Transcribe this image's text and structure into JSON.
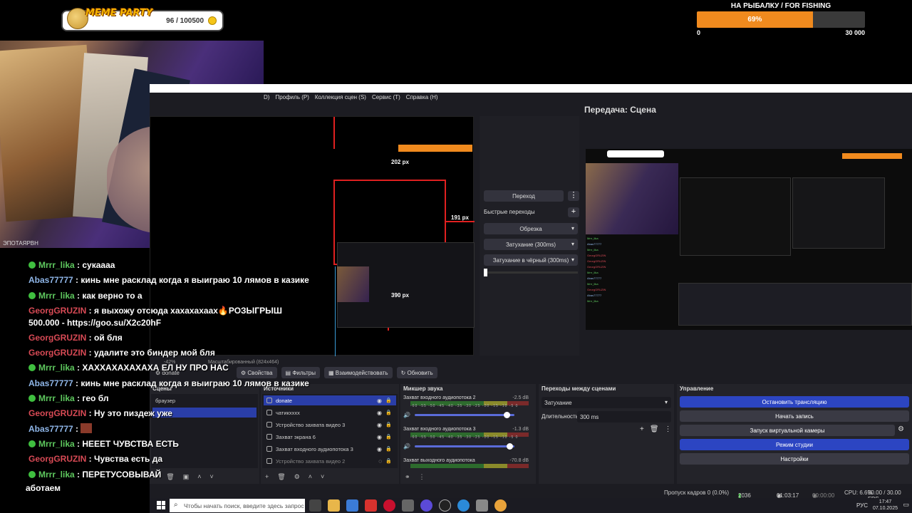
{
  "overlay": {
    "meme_party": {
      "title": "MEME PARTY",
      "count": "96 / 100500"
    },
    "fishing": {
      "title": "НА РЫБАЛКУ / FOR FISHING",
      "percent_label": "69%",
      "progress": 0.69,
      "min": "0",
      "max": "30 000"
    },
    "webcam_caption": "ЭПОТАЯРВН"
  },
  "chat": {
    "messages": [
      {
        "user": "Mrrr_lika",
        "text": "сукаааа",
        "color": "green",
        "badge": true
      },
      {
        "user": "Abas77777",
        "text": "кинь мне расклад когда я выиграю 10 лямов в казике",
        "color": "blue",
        "badge": false
      },
      {
        "user": "Mrrr_lika",
        "text": "как верно то а",
        "color": "green",
        "badge": true
      },
      {
        "user": "GeorgGRUZIN",
        "text": "я выхожу отсюда хахахахаах🔥РОЗЫГРЫШ 500.000 - https://goo.su/X2c20hF",
        "color": "red",
        "badge": false
      },
      {
        "user": "GeorgGRUZIN",
        "text": "ой бля",
        "color": "red",
        "badge": false
      },
      {
        "user": "GeorgGRUZIN",
        "text": "удалите это биндер мой бля",
        "color": "red",
        "badge": false
      },
      {
        "user": "Mrrr_lika",
        "text": "ХАХХАХАХАХАХА ЕЛ НУ ПРО НАС",
        "color": "green",
        "badge": true
      },
      {
        "user": "Abas77777",
        "text": "кинь мне расклад когда я выиграю 10 лямов в казике",
        "color": "blue",
        "badge": false
      },
      {
        "user": "Mrrr_lika",
        "text": "гео бл",
        "color": "green",
        "badge": true
      },
      {
        "user": "GeorgGRUZIN",
        "text": "Ну это пиздеж уже",
        "color": "red",
        "badge": false
      },
      {
        "user": "Abas77777",
        "text": "",
        "color": "blue",
        "badge": false,
        "emote": true
      },
      {
        "user": "Mrrr_lika",
        "text": "НЕЕЕТ ЧУВСТВА ЕСТЬ",
        "color": "green",
        "badge": true
      },
      {
        "user": "GeorgGRUZIN",
        "text": "Чувства есть да",
        "color": "red",
        "badge": false
      },
      {
        "user": "Mrrr_lika",
        "text": "ПЕРЕТУСОВЫВАЙ",
        "color": "green",
        "badge": true
      }
    ],
    "tail": "аботаем"
  },
  "obs": {
    "menu": [
      "D)",
      "Профиль (P)",
      "Коллекция сцен (S)",
      "Сервис (T)",
      "Справка (H)"
    ],
    "program_title": "Передача: Сцена",
    "measures": {
      "top": "202 px",
      "right": "191 px",
      "bottom": "390 px"
    },
    "transitions_panel": {
      "transition_button": "Переход",
      "quick_transitions": "Быстрые переходы",
      "items": [
        "Обрезка",
        "Затухание (300ms)",
        "Затухание в чёрный (300ms)"
      ]
    },
    "toolbar": {
      "zoom": "-42%",
      "scale_label": "Масштабированный (824x464)"
    },
    "scene_name": "donate",
    "buttons": {
      "properties": "Свойства",
      "filters": "Фильтры",
      "interact": "Взаимодействовать",
      "refresh": "Обновить"
    },
    "scenes": {
      "title": "Сцены",
      "items": [
        "браузер",
        ""
      ]
    },
    "sources": {
      "title": "Источники",
      "items": [
        "donate",
        "чатикхххх",
        "Устройство захвата видео 3",
        "Захват экрана 6",
        "Захват входного аудиопотока 3",
        "Устройство захвата видео 2"
      ]
    },
    "mixer": {
      "title": "Микшер звука",
      "channels": [
        {
          "name": "Захват входного аудиопотока 2",
          "db": "-2.5 dB",
          "volume": 0.92
        },
        {
          "name": "Захват входного аудиопотока 3",
          "db": "-1.3 dB",
          "volume": 0.95
        },
        {
          "name": "Захват выходного аудиопотока",
          "db": "-70.8 dB",
          "volume": 0.0
        }
      ],
      "scale": "-60 -55 -50 -45 -40 -35 -30 -25 -20 -15 -10 -5 0"
    },
    "scene_transitions": {
      "title": "Переходы между сценами",
      "type": "Затухание",
      "duration_label": "Длительность",
      "duration": "300 ms"
    },
    "controls": {
      "title": "Управление",
      "buttons": [
        "Остановить трансляцию",
        "Начать запись",
        "Запуск виртуальной камеры",
        "Режим студии",
        "Настройки"
      ]
    },
    "status": {
      "dropped": "Пропуск кадров 0 (0.0%)",
      "bitrate": "2036 kbps",
      "live_time": "01:03:17",
      "rec_time": "00:00:00",
      "cpu": "CPU: 6.6%",
      "fps": "30.00 / 30.00 FPS"
    }
  },
  "taskbar": {
    "search_placeholder": "Чтобы начать поиск, введите здесь запрос",
    "lang": "РУС",
    "time": "17:47",
    "date": "07.10.2025"
  },
  "colors": {
    "accent_blue": "#2c45c2",
    "fishing_orange": "#f08a1e",
    "chat_green": "#5ec85e",
    "chat_red": "#d84a55",
    "chat_blue": "#8fb6e8"
  }
}
